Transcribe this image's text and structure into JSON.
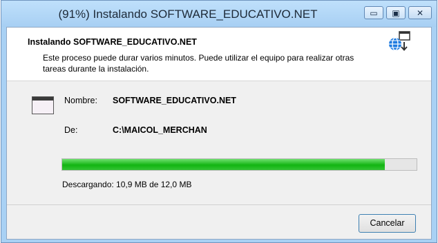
{
  "window": {
    "title": "(91%) Instalando SOFTWARE_EDUCATIVO.NET",
    "minimize_glyph": "▭",
    "maximize_glyph": "▣",
    "close_glyph": "✕"
  },
  "header": {
    "title": "Instalando SOFTWARE_EDUCATIVO.NET",
    "description": "Este proceso puede durar varios minutos. Puede utilizar el equipo para realizar otras tareas durante la instalación.",
    "icon": "globe-download-icon"
  },
  "details": {
    "app_icon": "application-window-icon",
    "name_label": "Nombre:",
    "name_value": "SOFTWARE_EDUCATIVO.NET",
    "from_label": "De:",
    "from_value": "C:\\MAICOL_MERCHAN"
  },
  "progress": {
    "percent": 91,
    "status_text": "Descargando: 10,9 MB de 12,0 MB",
    "fill_color": "#14b814"
  },
  "buttons": {
    "cancel_label": "Cancelar"
  }
}
